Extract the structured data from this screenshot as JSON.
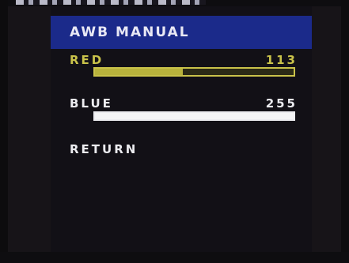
{
  "menu": {
    "title": "AWB MANUAL",
    "items": [
      {
        "label": "RED",
        "value": "113",
        "level_fraction": 0.443,
        "color": "#c9c24a"
      },
      {
        "label": "BLUE",
        "value": "255",
        "level_fraction": 1.0,
        "color": "#ececf0"
      }
    ],
    "return_label": "RETURN"
  },
  "colors": {
    "title_bar": "#1b2a8a",
    "background": "#121016",
    "highlight": "#c9c24a",
    "text": "#ececf0"
  }
}
